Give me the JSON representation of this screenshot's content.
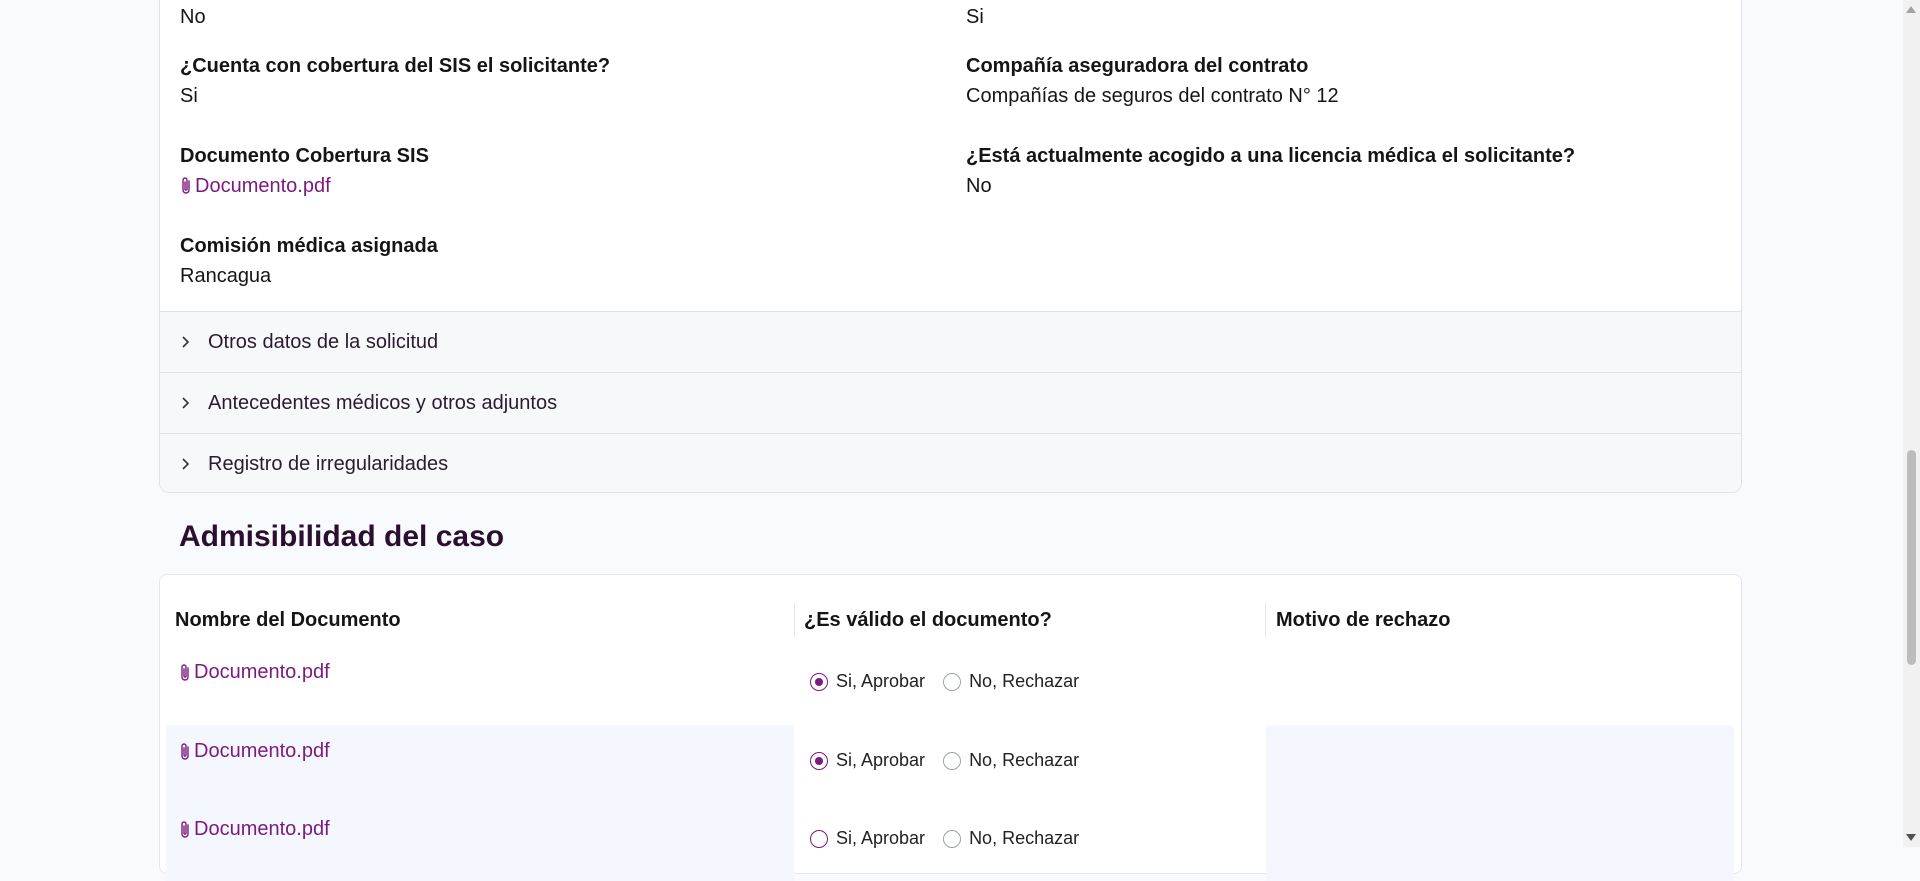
{
  "details": {
    "prev_left_value": "No",
    "prev_right_value": "Si",
    "fields": {
      "cobertura_sis_label": "¿Cuenta con cobertura del SIS el solicitante?",
      "cobertura_sis_value": "Si",
      "aseguradora_label": "Compañía aseguradora del contrato",
      "aseguradora_value": "Compañías de seguros del contrato N° 12",
      "documento_sis_label": "Documento Cobertura SIS",
      "documento_sis_link": "Documento.pdf",
      "licencia_label": "¿Está actualmente acogido a una licencia médica el solicitante?",
      "licencia_value": "No",
      "comision_label": "Comisión médica asignada",
      "comision_value": "Rancagua"
    },
    "accordions": [
      "Otros datos de la solicitud",
      "Antecedentes médicos y otros adjuntos",
      "Registro de irregularidades"
    ]
  },
  "admisibilidad": {
    "title": "Admisibilidad del caso",
    "columns": [
      "Nombre del Documento",
      "¿Es válido el documento?",
      "Motivo de rechazo"
    ],
    "rows": [
      {
        "document": "Documento.pdf",
        "approve_label": "Si, Aprobar",
        "reject_label": "No, Rechazar",
        "selected": "approve"
      },
      {
        "document": "Documento.pdf",
        "approve_label": "Si, Aprobar",
        "reject_label": "No, Rechazar",
        "selected": "approve"
      },
      {
        "document": "Documento.pdf",
        "approve_label": "Si, Aprobar",
        "reject_label": "No, Rechazar",
        "selected": "none"
      }
    ]
  },
  "colors": {
    "accent": "#7b1a7f",
    "heading": "#2a0f2e",
    "row_alt_bg": "#f4f7fd"
  }
}
